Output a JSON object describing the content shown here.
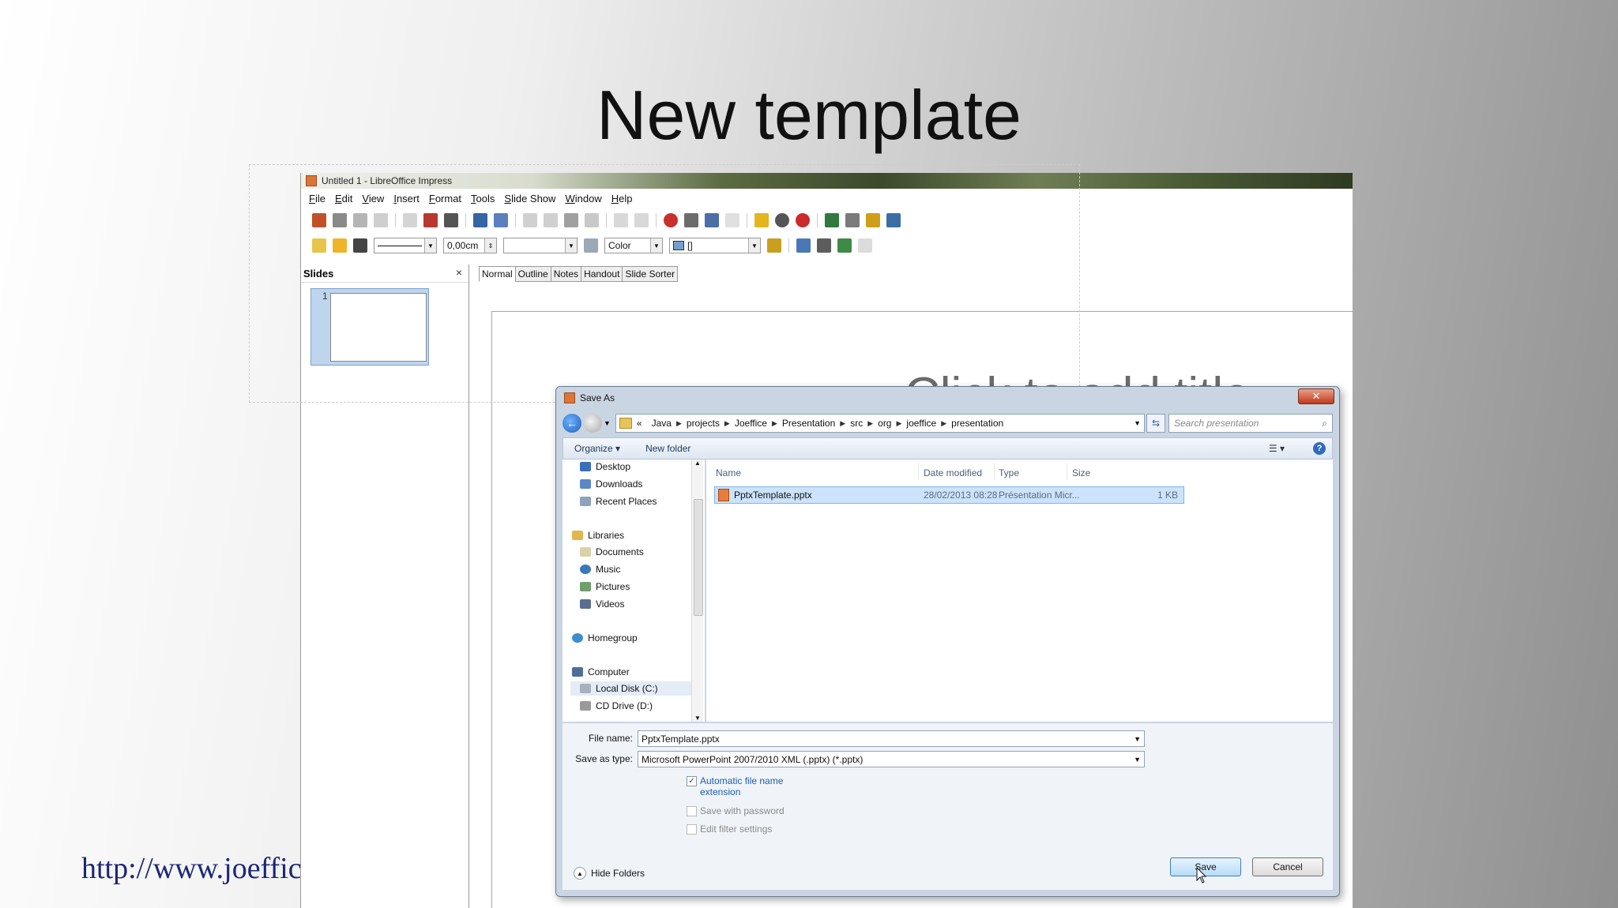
{
  "slide": {
    "title": "New template",
    "url": "http://www.joeffice",
    "placeholder_title": "Click to add title"
  },
  "window": {
    "title": "Untitled 1 - LibreOffice Impress",
    "menu": [
      "File",
      "Edit",
      "View",
      "Insert",
      "Format",
      "Tools",
      "Slide Show",
      "Window",
      "Help"
    ],
    "line_width": "0,00cm",
    "area_style": "Color",
    "area_value": "[]",
    "slides_pane_title": "Slides",
    "slides_pane_close": "×",
    "slide_number": "1",
    "view_tabs": [
      "Normal",
      "Outline",
      "Notes",
      "Handout",
      "Slide Sorter"
    ]
  },
  "dialog": {
    "title": "Save As",
    "close": "✕",
    "breadcrumb_prefix": "«",
    "breadcrumb": [
      "Java",
      "projects",
      "Joeffice",
      "Presentation",
      "src",
      "org",
      "joeffice",
      "presentation"
    ],
    "search_placeholder": "Search presentation",
    "organize": "Organize ▾",
    "new_folder": "New folder",
    "help": "?",
    "nav": {
      "desktop": "Desktop",
      "downloads": "Downloads",
      "recent": "Recent Places",
      "libraries": "Libraries",
      "documents": "Documents",
      "music": "Music",
      "pictures": "Pictures",
      "videos": "Videos",
      "homegroup": "Homegroup",
      "computer": "Computer",
      "local_disk": "Local Disk (C:)",
      "cd_drive": "CD Drive (D:)"
    },
    "columns": {
      "name": "Name",
      "date": "Date modified",
      "type": "Type",
      "size": "Size"
    },
    "files": [
      {
        "name": "PptxTemplate.pptx",
        "date": "28/02/2013 08:28",
        "type": "Présentation Micr...",
        "size": "1 KB"
      }
    ],
    "file_name_label": "File name:",
    "file_name_value": "PptxTemplate.pptx",
    "save_type_label": "Save as type:",
    "save_type_value": "Microsoft PowerPoint 2007/2010 XML (.pptx) (*.pptx)",
    "auto_ext_line1": "Automatic file name",
    "auto_ext_line2": "extension",
    "save_password": "Save with password",
    "edit_filter": "Edit filter settings",
    "check_mark": "✓",
    "hide_folders": "Hide Folders",
    "save_button": "Save",
    "cancel_button": "Cancel"
  }
}
